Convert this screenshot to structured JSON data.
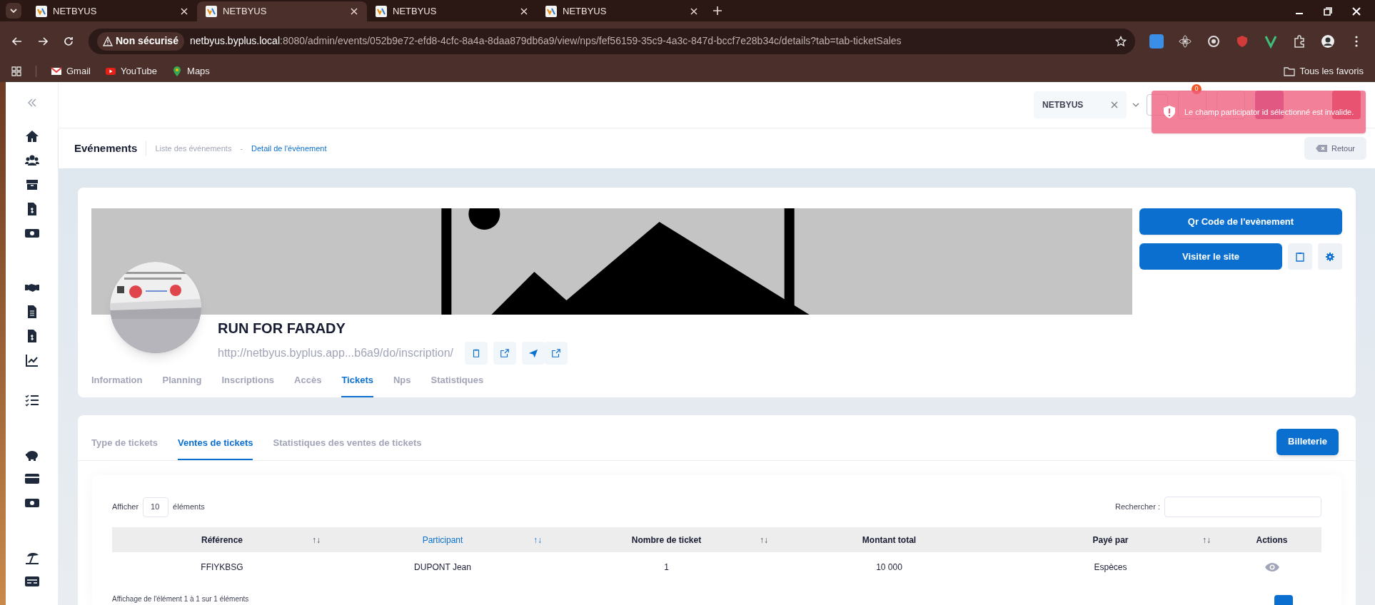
{
  "browser": {
    "tabs": [
      {
        "title": "NETBYUS",
        "selected": false
      },
      {
        "title": "NETBYUS",
        "selected": true
      },
      {
        "title": "NETBYUS",
        "selected": false
      },
      {
        "title": "NETBYUS",
        "selected": false
      }
    ],
    "security_label": "Non sécurisé",
    "url_host": "netbyus.byplus.local",
    "url_path": ":8080/admin/events/052b9e72-efd8-4cfc-8a4a-8daa879db6a9/view/nps/fef56159-35c9-4a3c-847d-bccf7e28b34c/details?tab=tab-ticketSales",
    "bookmarks": [
      {
        "label": "Gmail",
        "kind": "gmail"
      },
      {
        "label": "YouTube",
        "kind": "youtube"
      },
      {
        "label": "Maps",
        "kind": "maps"
      }
    ],
    "all_bookmarks": "Tous les favoris"
  },
  "header": {
    "organization": "NETBYUS",
    "notification_count": "0"
  },
  "toast": {
    "message": "Le champ participator id sélectionné est invalide."
  },
  "breadcrumb": {
    "title": "Evénements",
    "separator": "-",
    "items": [
      {
        "label": "Liste des événements",
        "current": false
      },
      {
        "label": "Detail de l'évènement",
        "current": true
      }
    ],
    "back": "Retour"
  },
  "event": {
    "name": "RUN FOR FARADY",
    "url": "http://netbyus.byplus.app...b6a9/do/inscription/",
    "qr_button": "Qr Code de l'evènement",
    "visit_button": "Visiter le site",
    "tabs": [
      {
        "label": "Information",
        "selected": false
      },
      {
        "label": "Planning",
        "selected": false
      },
      {
        "label": "Inscriptions",
        "selected": false
      },
      {
        "label": "Accès",
        "selected": false
      },
      {
        "label": "Tickets",
        "selected": true
      },
      {
        "label": "Nps",
        "selected": false
      },
      {
        "label": "Statistiques",
        "selected": false
      }
    ]
  },
  "ticket_tabs": [
    {
      "label": "Type de tickets",
      "selected": false
    },
    {
      "label": "Ventes de tickets",
      "selected": true
    },
    {
      "label": "Statistiques des ventes de tickets",
      "selected": false
    }
  ],
  "ticketing_button": "Billeterie",
  "table": {
    "show_label": "Afficher",
    "page_size": "10",
    "show_suffix": "éléments",
    "search_label": "Rechercher :",
    "columns": [
      {
        "label": "Référence",
        "sort_glyph": "↑↓",
        "sorted": false
      },
      {
        "label": "Participant",
        "sort_glyph": "↑↓",
        "sorted": true
      },
      {
        "label": "Nombre de ticket",
        "sort_glyph": "↑↓",
        "sorted": false
      },
      {
        "label": "Montant total",
        "sorted": false
      },
      {
        "label": "Payé par",
        "sort_glyph": "↑↓",
        "sorted": false
      },
      {
        "label": "Actions",
        "sorted": false
      }
    ],
    "rows": [
      {
        "cells": [
          "FFIYKBSG",
          "DUPONT Jean",
          "1",
          "10 000",
          "Espèces"
        ]
      }
    ],
    "info": "Affichage de l'élément 1 à 1 sur 1 éléments"
  }
}
